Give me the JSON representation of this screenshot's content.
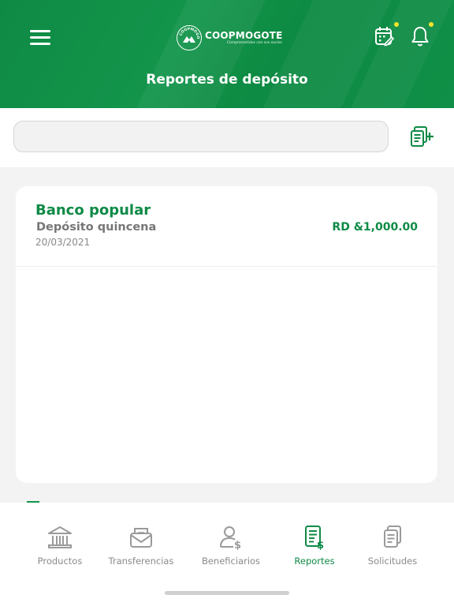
{
  "header": {
    "brand": "COOPMOGOTE",
    "brand_ring": "COOPMOGOTE",
    "tagline": "Comprometidos con sus socios",
    "title": "Reportes de depósito"
  },
  "search": {
    "value": "",
    "placeholder": ""
  },
  "reports": [
    {
      "bank": "Banco popular",
      "description": "Depósito quincena",
      "date": "20/03/2021",
      "amount": "RD &1,000.00"
    }
  ],
  "nav": {
    "items": [
      {
        "label": "Productos",
        "icon": "bank-icon",
        "active": false
      },
      {
        "label": "Transferencias",
        "icon": "envelope-transfer-icon",
        "active": false
      },
      {
        "label": "Beneficiarios",
        "icon": "user-dollar-icon",
        "active": false
      },
      {
        "label": "Reportes",
        "icon": "report-dollar-icon",
        "active": true
      },
      {
        "label": "Solicitudes",
        "icon": "documents-icon",
        "active": false
      }
    ]
  },
  "colors": {
    "brand_green": "#0e8a46",
    "header_green": "#13954b",
    "notification_dot": "#f3e62a",
    "inactive_gray": "#8a8a8a"
  }
}
